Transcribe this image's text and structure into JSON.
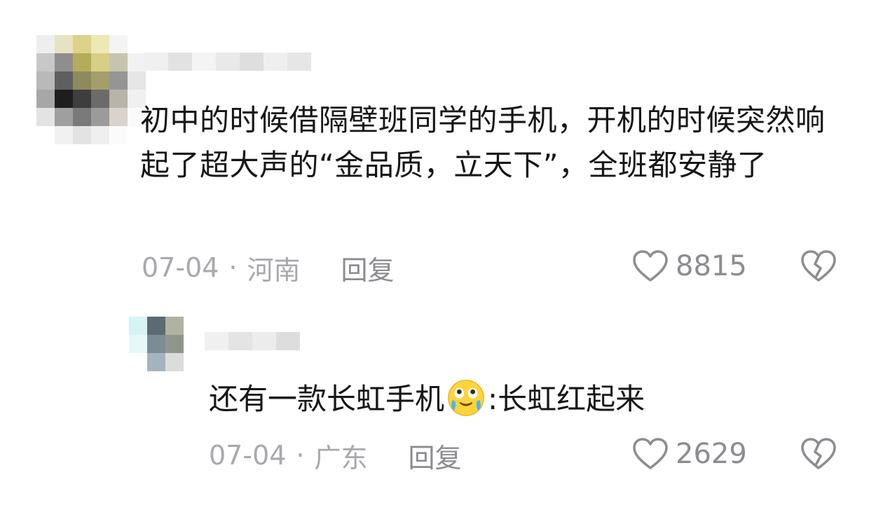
{
  "comment": {
    "text": "初中的时候借隔壁班同学的手机，开机的时候突然响起了超大声的“金品质，立天下”，全班都安静了",
    "date": "07-04",
    "separator": "·",
    "location": "河南",
    "reply_label": "回复",
    "likes": "8815",
    "avatar_pixels": [
      "#eeeeee",
      "#e6e2c4",
      "#ddd28a",
      "#ede9b6",
      "#f4f4f4",
      "#ffffff",
      "#c8c8c8",
      "#8e8e8e",
      "#b5ac5a",
      "#d8cf86",
      "#c7c4ae",
      "#f2f2f2",
      "#b9b9b9",
      "#5f5f5f",
      "#8e8a5e",
      "#a49e6c",
      "#959595",
      "#e6e6e6",
      "#a7a7a7",
      "#1e1e1e",
      "#3e3e3e",
      "#6b6b6b",
      "#b9b4a8",
      "#f0f0f0",
      "#e3e3e3",
      "#9f9f9f",
      "#7a7a7a",
      "#9b9b9b",
      "#d9d3cc",
      "#fafafa",
      "#ffffff",
      "#f1f1f1",
      "#e3e3e3",
      "#efefef",
      "#fbfbfb",
      "#ffffff"
    ],
    "name_pixels": [
      "#f0f0f0",
      "#e2e2e2",
      "#f4f4f4",
      "#e9e9e9",
      "#dedede",
      "#efefef",
      "#e6e6e6"
    ]
  },
  "reply": {
    "text_before": "还有一款长虹手机",
    "emoji": "laughing-crying-emoji",
    "text_after": ":长虹红起来",
    "date": "07-04",
    "separator": "·",
    "location": "广东",
    "reply_label": "回复",
    "likes": "2629",
    "avatar_pixels": [
      "#d7f4f4",
      "#5b6a73",
      "#b0b3a0",
      "#e8f7f7",
      "#7b8c95",
      "#8f968c",
      "#ffffff",
      "#a4b4bc",
      "#dcdcdc"
    ],
    "name_pixels": [
      "#f0f0f0",
      "#e4e4e4",
      "#ececec",
      "#dddddd"
    ]
  },
  "colors": {
    "text": "#161616",
    "meta": "#a8a8ad",
    "icon": "#8c8c91"
  }
}
